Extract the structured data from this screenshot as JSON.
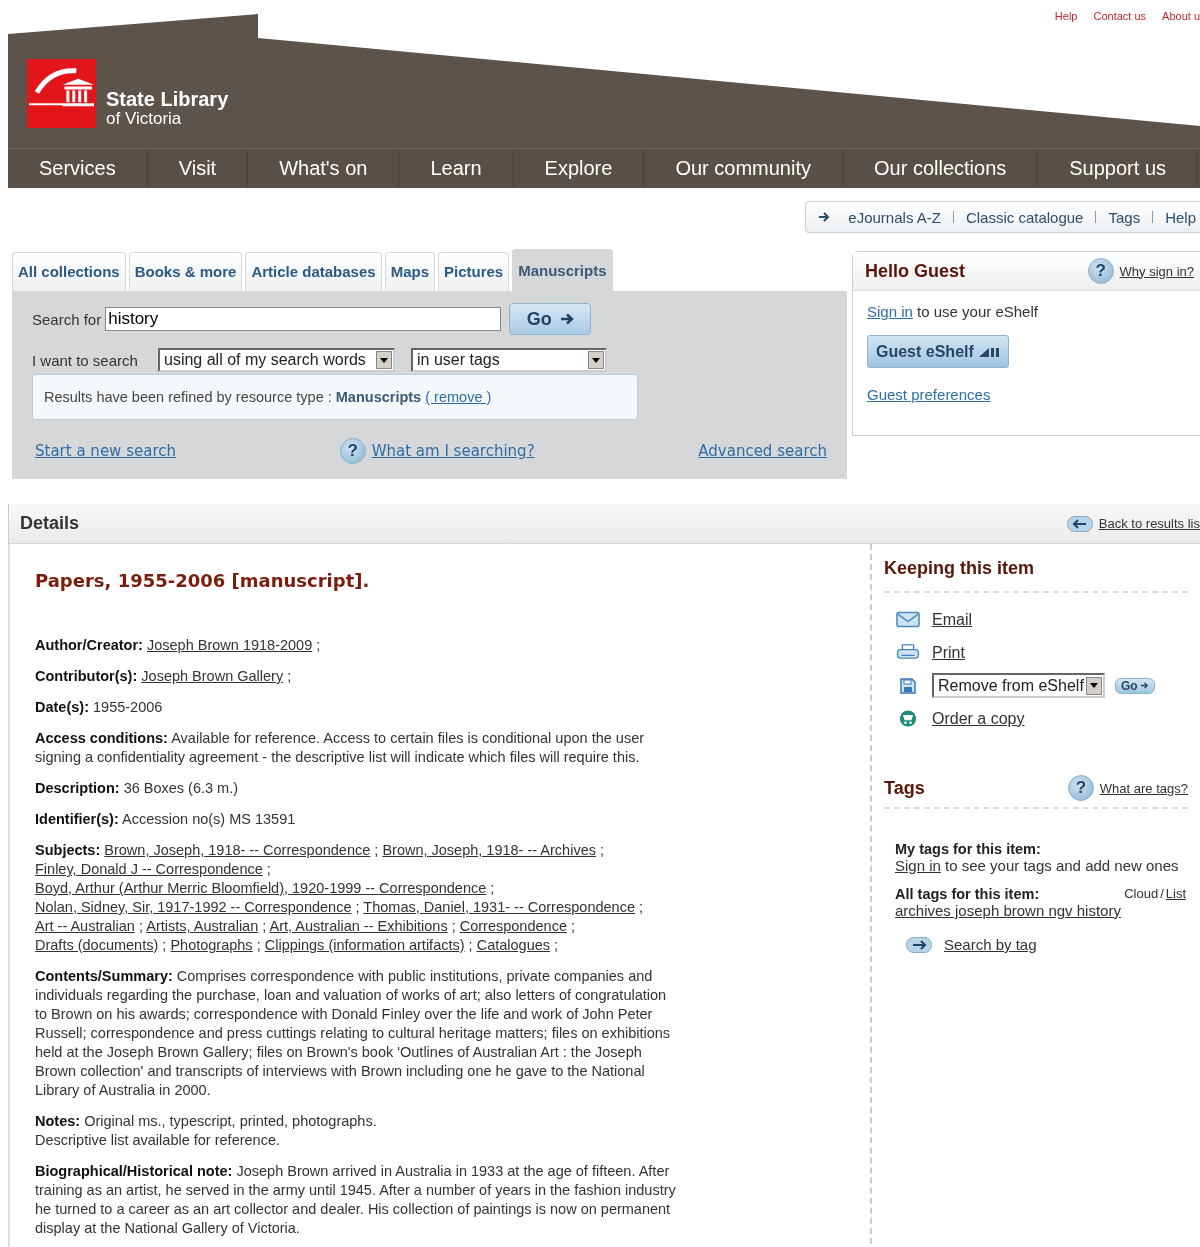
{
  "utility_links": [
    "Help",
    "Contact us",
    "About u"
  ],
  "logo": {
    "name": "State Library",
    "subtitle": "of Victoria"
  },
  "nav": [
    "Services",
    "Visit",
    "What's on",
    "Learn",
    "Explore",
    "Our community",
    "Our collections",
    "Support us"
  ],
  "quick_links": [
    "eJournals A-Z",
    "Classic catalogue",
    "Tags",
    "Help"
  ],
  "search_tabs": [
    {
      "label": "All collections",
      "selected": false
    },
    {
      "label": "Books & more",
      "selected": false
    },
    {
      "label": "Article databases",
      "selected": false
    },
    {
      "label": "Maps",
      "selected": false
    },
    {
      "label": "Pictures",
      "selected": false
    },
    {
      "label": "Manuscripts",
      "selected": true
    }
  ],
  "search": {
    "label": "Search for",
    "value": "history",
    "go": "Go",
    "mode_label": "I want to search",
    "mode": "using all of my search words",
    "scope": "in user tags",
    "refine": {
      "text": "Results have been refined by resource type :",
      "type": "Manuscripts",
      "link": "( remove )"
    },
    "new_search": "Start a new search",
    "help_icon": "?",
    "help": "What am I searching?",
    "advanced": "Advanced search"
  },
  "account": {
    "title": "Hello Guest",
    "help_icon": "?",
    "help": "Why sign in?",
    "sign_in": "Sign in",
    "sign_in_text": "to use your eShelf",
    "eshelf_button": "Guest eShelf",
    "preferences": "Guest preferences"
  },
  "details": {
    "title": "Details",
    "back": "Back to results lis"
  },
  "record": {
    "title": "Papers, 1955-2006 [manuscript].",
    "fields": [
      {
        "kind": "links",
        "label": "Author/Creator:",
        "separator": ";",
        "links": [
          "Joseph Brown 1918-2009"
        ]
      },
      {
        "kind": "links",
        "label": "Contributor(s):",
        "separator": ";",
        "links": [
          "Joseph Brown Gallery"
        ]
      },
      {
        "kind": "text",
        "label": "Date(s):",
        "lines": [
          "1955-2006"
        ]
      },
      {
        "kind": "text",
        "label": "Access conditions:",
        "lines": [
          "Available for reference. Access to certain files is conditional upon the user signing a confidentiality agreement - the descriptive list will indicate which files will require this."
        ]
      },
      {
        "kind": "text",
        "label": "Description:",
        "lines": [
          "36 Boxes (6.3 m.)"
        ]
      },
      {
        "kind": "text",
        "label": "Identifier(s):",
        "lines": [
          "Accession no(s) MS 13591"
        ]
      },
      {
        "kind": "links",
        "label": "Subjects:",
        "separator": ";",
        "links": [
          "Brown, Joseph, 1918- -- Correspondence",
          "Brown, Joseph, 1918- -- Archives",
          "Finley, Donald J -- Correspondence",
          "Boyd, Arthur (Arthur Merric Bloomfield), 1920-1999 -- Correspondence",
          "Nolan, Sidney, Sir, 1917-1992 -- Correspondence",
          "Thomas, Daniel, 1931- -- Correspondence",
          "Art -- Australian",
          "Artists, Australian",
          "Art, Australian -- Exhibitions",
          "Correspondence",
          "Drafts (documents)",
          "Photographs",
          "Clippings (information artifacts)",
          "Catalogues"
        ]
      },
      {
        "kind": "text",
        "label": "Contents/Summary:",
        "lines": [
          "Comprises correspondence with public institutions, private companies and individuals regarding the purchase, loan and valuation of works of art; also letters of congratulation to Brown on his awards; correspondence with Donald Finley over the life and work of John Peter Russell; correspondence and press cuttings relating to cultural heritage matters; files on exhibitions held at the Joseph Brown Gallery; files on Brown's book 'Outlines of Australian Art : the Joseph Brown collection' and transcripts of interviews with Brown including one he gave to the National Library of Australia in 2000."
        ]
      },
      {
        "kind": "text",
        "label": "Notes:",
        "lines": [
          "Original ms., typescript, printed, photographs.",
          "Descriptive list available for reference."
        ]
      },
      {
        "kind": "text",
        "label": "Biographical/Historical note:",
        "lines": [
          "Joseph Brown arrived in Australia in 1933 at the age of fifteen. After training as an artist, he served in the army until 1945. After a number of years in the fashion industry he turned to a career as an art collector and dealer. His collection of paintings is now on permanent display at the National Gallery of Victoria."
        ]
      }
    ]
  },
  "keeping": {
    "title": "Keeping this item",
    "actions": [
      {
        "kind": "email",
        "label": "Email"
      },
      {
        "kind": "print",
        "label": "Print"
      },
      {
        "kind": "shelf",
        "label": "Remove from eShelf",
        "go": "Go"
      },
      {
        "kind": "order",
        "label": "Order a copy"
      }
    ]
  },
  "tags": {
    "title": "Tags",
    "help_icon": "?",
    "help": "What are tags?",
    "my_label": "My tags for this item:",
    "sign_in": "Sign in",
    "sign_in_text": "to see your tags and add new ones",
    "all_label": "All tags for this item:",
    "cloud": "Cloud",
    "slash": "/",
    "list": "List",
    "all_tags": "archives joseph brown ngv history",
    "search_by_tag": "Search by tag"
  }
}
